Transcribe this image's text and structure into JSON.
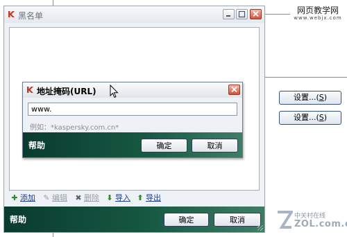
{
  "watermark_top": {
    "line1": "网页教学网",
    "line2": "www.webjx.com"
  },
  "side_buttons": [
    {
      "label": "设置...(",
      "key": "S",
      "close": ")"
    },
    {
      "label": "设置...(",
      "key": "S",
      "close": ")"
    }
  ],
  "main_window": {
    "title": "黑名单",
    "toolbar": [
      {
        "icon": "plus-icon",
        "glyph": "✚",
        "label": "添加",
        "color": "#2e8b2e",
        "enabled": true
      },
      {
        "icon": "pencil-icon",
        "glyph": "✎",
        "label": "编辑",
        "color": "#9aa0a8",
        "enabled": false
      },
      {
        "icon": "x-icon",
        "glyph": "✖",
        "label": "删除",
        "color": "#5a6068",
        "enabled": false
      },
      {
        "icon": "arrow-down-icon",
        "glyph": "⬇",
        "label": "导入",
        "color": "#2e8b2e",
        "enabled": true
      },
      {
        "icon": "arrow-up-icon",
        "glyph": "⬆",
        "label": "导出",
        "color": "#2e8b2e",
        "enabled": true
      }
    ],
    "footer": {
      "help": "帮助",
      "ok": "确定",
      "cancel": "取消"
    }
  },
  "url_dialog": {
    "title": "地址掩码(URL)",
    "input_value": "www.",
    "example": "例如：*kaspersky.com.cn*",
    "footer": {
      "help": "帮助",
      "ok": "确定",
      "cancel": "取消"
    }
  },
  "watermark_bottom": {
    "chinese": "中关村在线",
    "english": "ZOL.com.cn"
  },
  "colors": {
    "footer_green": "#165842",
    "close_red": "#d4513b",
    "link_blue": "#1f3d8a"
  }
}
